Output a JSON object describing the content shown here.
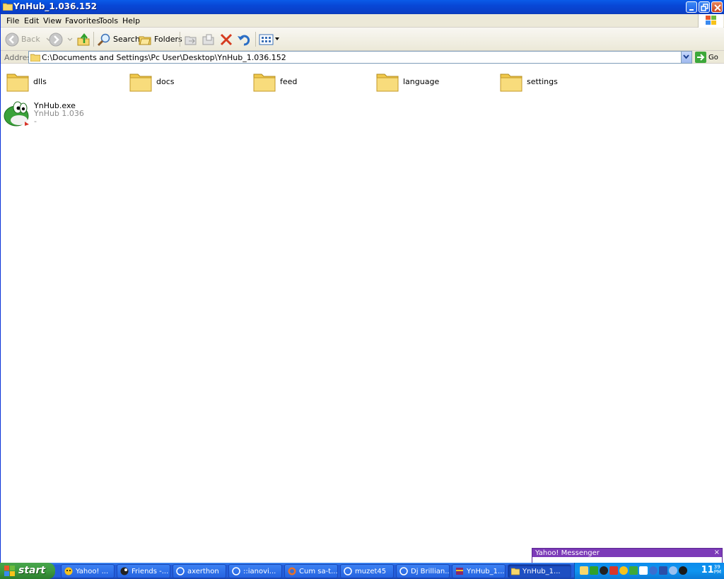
{
  "window": {
    "title": "YnHub_1.036.152"
  },
  "menu": [
    "File",
    "Edit",
    "View",
    "Favorites",
    "Tools",
    "Help"
  ],
  "toolbar": {
    "back": "Back",
    "search": "Search",
    "folders": "Folders"
  },
  "address": {
    "label": "Address",
    "path": "C:\\Documents and Settings\\Pc User\\Desktop\\YnHub_1.036.152",
    "go": "Go"
  },
  "folders": [
    "dlls",
    "docs",
    "feed",
    "language",
    "settings"
  ],
  "exe": {
    "name": "YnHub.exe",
    "description": "YnHub 1.036",
    "extra": "-"
  },
  "popup": {
    "title": "Yahoo! Messenger",
    "close": "×"
  },
  "taskbar": {
    "start": "start",
    "tasks": [
      "Yahoo! ...",
      "Friends -...",
      "axerthon",
      "::ianovi...",
      "Cum sa-t...",
      "muzet45",
      "Dj Brillian...",
      "YnHub_1...",
      "YnHub_1..."
    ],
    "clock": "11",
    "clock_small": "39",
    "clock_ampm": "PM"
  },
  "colors": {
    "titlebar": "#0a5be8",
    "taskbar": "#245edb",
    "start": "#3c9a3f",
    "tray": "#0f95f0",
    "folder": "#f6d76d"
  }
}
